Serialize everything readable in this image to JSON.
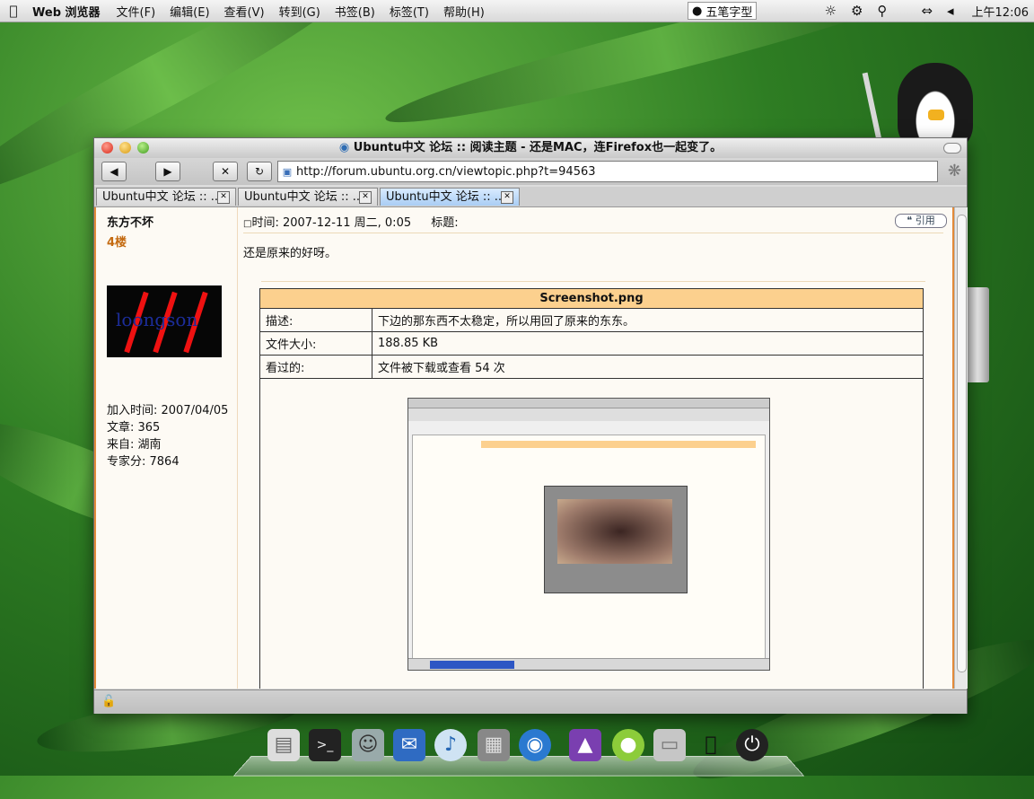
{
  "menubar": {
    "app_name": "Web 浏览器",
    "menus": [
      "文件(F)",
      "编辑(E)",
      "查看(V)",
      "转到(G)",
      "书签(B)",
      "标签(T)",
      "帮助(H)"
    ],
    "ime_label": "五笔字型",
    "clock": "上午12:06"
  },
  "window": {
    "title": "Ubuntu中文 论坛 :: 阅读主题 - 还是MAC，连Firefox也一起变了。",
    "url": "http://forum.ubuntu.org.cn/viewtopic.php?t=94563",
    "tabs": [
      {
        "label": "Ubuntu中文 论坛 :: ...",
        "active": false
      },
      {
        "label": "Ubuntu中文 论坛 :: ...",
        "active": false
      },
      {
        "label": "Ubuntu中文 论坛 :: ...",
        "active": true
      }
    ]
  },
  "author": {
    "name": "东方不坏",
    "floor": "4楼",
    "avatar_text": "loongson",
    "joined": "加入时间: 2007/04/05",
    "posts": "文章: 365",
    "from": "来自: 湖南",
    "score": "专家分: 7864"
  },
  "post": {
    "time": "时间: 2007-12-11 周二, 0:05",
    "subject_label": "标题:",
    "quote_label": "引用",
    "body": "还是原来的好呀。"
  },
  "attachment": {
    "filename": "Screenshot.png",
    "rows": [
      {
        "label": "描述:",
        "value": "下边的那东西不太稳定，所以用回了原来的东东。"
      },
      {
        "label": "文件大小:",
        "value": "188.85 KB"
      },
      {
        "label": "看过的:",
        "value": "文件被下载或查看 54 次"
      }
    ]
  },
  "colors": {
    "accent_orange": "#e28a3a",
    "table_header": "#fcd08e",
    "active_tab": "#a9cdf4"
  },
  "dock": {
    "icons": [
      "document-icon",
      "terminal-icon",
      "finder-icon",
      "email-icon",
      "itunes-icon",
      "safe-icon",
      "browser-globe-icon",
      "photo-icon",
      "apple-fruit-icon",
      "folder-icon",
      "apple-logo-icon",
      "power-icon"
    ]
  }
}
